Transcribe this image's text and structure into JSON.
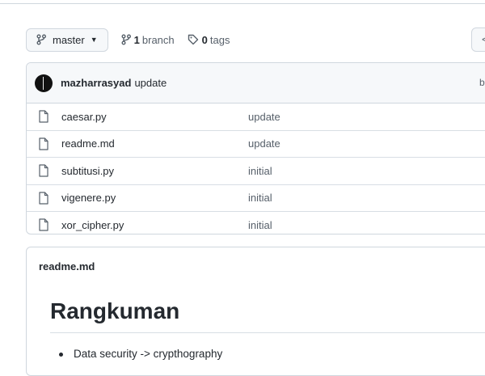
{
  "toolbar": {
    "branch_name": "master",
    "branches_count": "1",
    "branches_label": "branch",
    "tags_count": "0",
    "tags_label": "tags"
  },
  "latest_commit": {
    "author": "mazharrasyad",
    "message": "update",
    "right_text": "b"
  },
  "files": [
    {
      "name": "caesar.py",
      "commit": "update"
    },
    {
      "name": "readme.md",
      "commit": "update"
    },
    {
      "name": "subtitusi.py",
      "commit": "initial"
    },
    {
      "name": "vigenere.py",
      "commit": "initial"
    },
    {
      "name": "xor_cipher.py",
      "commit": "initial"
    }
  ],
  "readme": {
    "filename": "readme.md",
    "heading": "Rangkuman",
    "items": [
      "Data security -> crypthography"
    ]
  }
}
